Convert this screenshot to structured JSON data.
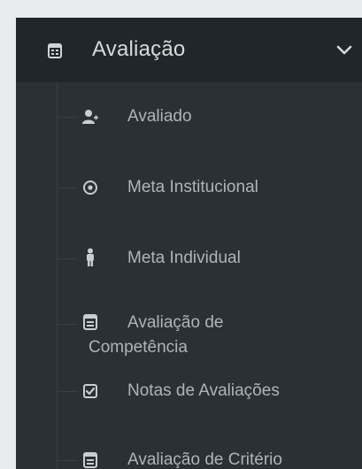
{
  "menu": {
    "title": "Avaliação",
    "header_icon": "calendar-icon",
    "expand_icon": "chevron-down-icon",
    "items": [
      {
        "label": "Avaliado",
        "icon": "user-plus-icon"
      },
      {
        "label": "Meta Institucional",
        "icon": "target-icon"
      },
      {
        "label": "Meta Individual",
        "icon": "person-icon"
      },
      {
        "label_line1": "Avaliação de",
        "label_line2": "Competência",
        "icon": "calendar-icon"
      },
      {
        "label": "Notas de Avaliações",
        "icon": "check-square-icon"
      },
      {
        "label": "Avaliação de Critério",
        "icon": "calendar-icon"
      }
    ]
  }
}
